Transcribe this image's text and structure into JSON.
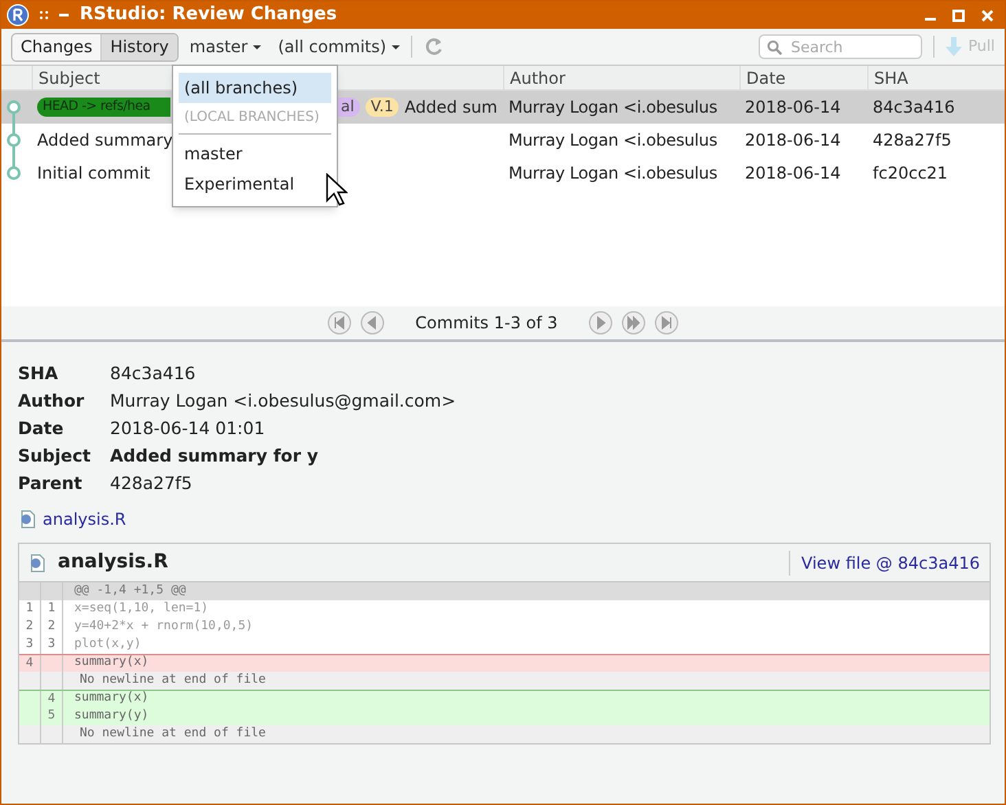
{
  "window": {
    "title": "RStudio: Review Changes"
  },
  "tabs": [
    {
      "label": "Changes",
      "selected": false
    },
    {
      "label": "History",
      "selected": true
    }
  ],
  "branch": {
    "label": "master"
  },
  "filter": {
    "label": "(all commits)"
  },
  "search": {
    "placeholder": "Search"
  },
  "pull": {
    "label": "Pull",
    "disabled": true
  },
  "table": {
    "columns": [
      "Subject",
      "Author",
      "Date",
      "SHA"
    ],
    "rows": [
      {
        "selected": true,
        "tags": [
          {
            "text": "HEAD -> refs/hea",
            "color": "#1a8a1a",
            "kind": "cut_right"
          },
          {
            "text": "al",
            "color": "#d6b8f0",
            "kind": "cut_left"
          },
          {
            "text": "V.1",
            "color": "#fbe3a6",
            "kind": "whole"
          }
        ],
        "subject": "Added sum",
        "author": "Murray Logan <i.obesulus",
        "date": "2018-06-14",
        "sha": "84c3a416"
      },
      {
        "selected": false,
        "tags": [],
        "subject": "Added summary",
        "author": "Murray Logan <i.obesulus",
        "date": "2018-06-14",
        "sha": "428a27f5"
      },
      {
        "selected": false,
        "tags": [],
        "subject": "Initial commit",
        "author": "Murray Logan <i.obesulus",
        "date": "2018-06-14",
        "sha": "fc20cc21"
      }
    ]
  },
  "menu": {
    "items": [
      {
        "kind": "option",
        "label": "(all branches)",
        "selected": true
      },
      {
        "kind": "header",
        "label": "(LOCAL BRANCHES)",
        "selected": false
      },
      {
        "kind": "option",
        "label": "master",
        "selected": false
      },
      {
        "kind": "option",
        "label": "Experimental",
        "selected": false
      }
    ]
  },
  "pager": {
    "label": "Commits 1-3 of 3"
  },
  "details": [
    {
      "label": "SHA",
      "value": "84c3a416",
      "bold": false
    },
    {
      "label": "Author",
      "value": "Murray Logan <i.obesulus@gmail.com>",
      "bold": false
    },
    {
      "label": "Date",
      "value": "2018-06-14 01:01",
      "bold": false
    },
    {
      "label": "Subject",
      "value": "Added summary for y",
      "bold": true
    },
    {
      "label": "Parent",
      "value": "428a27f5",
      "bold": false
    }
  ],
  "files": [
    "analysis.R"
  ],
  "diff": {
    "filename": "analysis.R",
    "view_link": "View file @ 84c3a416",
    "hunk": "@@ -1,4 +1,5 @@",
    "lines": [
      {
        "kind": "context",
        "old": "1",
        "new": "1",
        "text": "x=seq(1,10, len=1)"
      },
      {
        "kind": "context",
        "old": "2",
        "new": "2",
        "text": "y=40+2*x + rnorm(10,0,5)"
      },
      {
        "kind": "context",
        "old": "3",
        "new": "3",
        "text": "plot(x,y)"
      },
      {
        "kind": "deleted",
        "old": "4",
        "text": "summary(x)"
      },
      {
        "kind": "note",
        "text": "No newline at end of file"
      },
      {
        "kind": "added",
        "new": "4",
        "text": "summary(x)"
      },
      {
        "kind": "added",
        "new": "5",
        "text": "summary(y)"
      },
      {
        "kind": "note",
        "text": "No newline at end of file"
      }
    ]
  }
}
